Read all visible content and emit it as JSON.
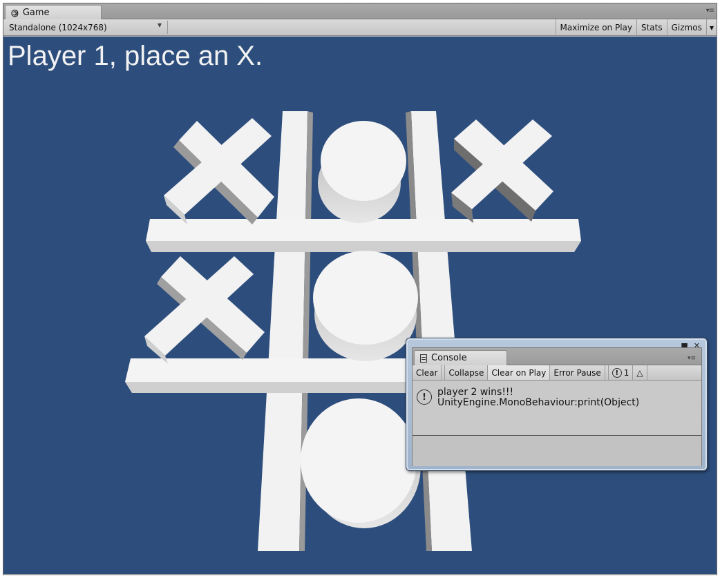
{
  "game_window": {
    "tab_label": "Game",
    "tab_icon": "pacman-icon",
    "toolbar": {
      "aspect_dropdown": "Standalone (1024x768)",
      "maximize_on_play": "Maximize on Play",
      "stats": "Stats",
      "gizmos": "Gizmos"
    }
  },
  "game_view": {
    "status_text": "Player 1, place an X.",
    "background_color": "#2d4e7d",
    "board": {
      "rows": [
        [
          "X",
          "O",
          "X"
        ],
        [
          "X",
          "O",
          ""
        ],
        [
          "",
          "O",
          ""
        ]
      ]
    }
  },
  "console": {
    "tab_label": "Console",
    "toolbar": {
      "clear": "Clear",
      "collapse": "Collapse",
      "clear_on_play": "Clear on Play",
      "error_pause": "Error Pause",
      "warning_count": "1"
    },
    "entries": [
      {
        "icon": "info-icon",
        "line1": "player 2 wins!!!",
        "line2": "UnityEngine.MonoBehaviour:print(Object)"
      }
    ]
  }
}
